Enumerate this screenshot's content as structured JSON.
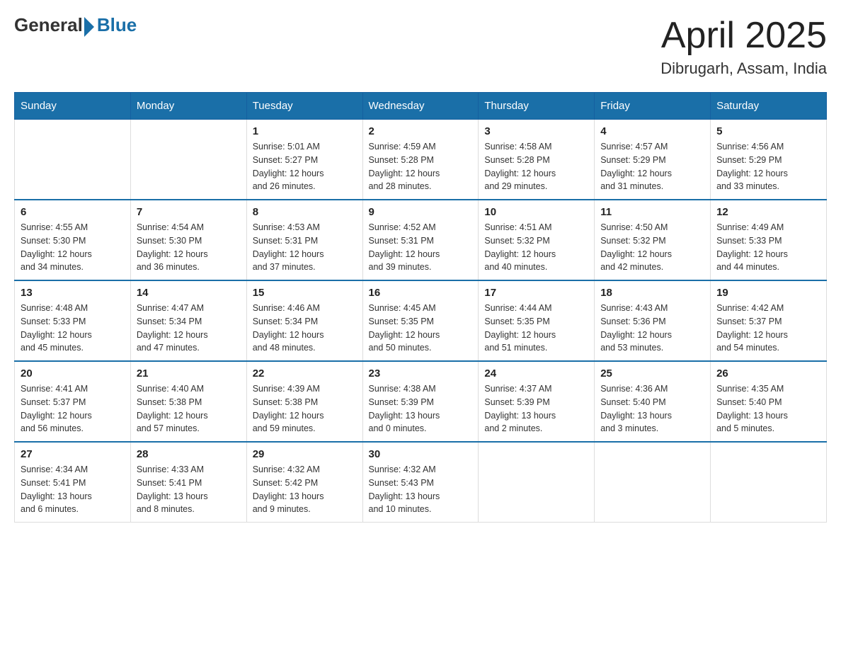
{
  "header": {
    "logo_general": "General",
    "logo_blue": "Blue",
    "title": "April 2025",
    "subtitle": "Dibrugarh, Assam, India"
  },
  "days_of_week": [
    "Sunday",
    "Monday",
    "Tuesday",
    "Wednesday",
    "Thursday",
    "Friday",
    "Saturday"
  ],
  "weeks": [
    [
      {
        "day": "",
        "info": ""
      },
      {
        "day": "",
        "info": ""
      },
      {
        "day": "1",
        "info": "Sunrise: 5:01 AM\nSunset: 5:27 PM\nDaylight: 12 hours\nand 26 minutes."
      },
      {
        "day": "2",
        "info": "Sunrise: 4:59 AM\nSunset: 5:28 PM\nDaylight: 12 hours\nand 28 minutes."
      },
      {
        "day": "3",
        "info": "Sunrise: 4:58 AM\nSunset: 5:28 PM\nDaylight: 12 hours\nand 29 minutes."
      },
      {
        "day": "4",
        "info": "Sunrise: 4:57 AM\nSunset: 5:29 PM\nDaylight: 12 hours\nand 31 minutes."
      },
      {
        "day": "5",
        "info": "Sunrise: 4:56 AM\nSunset: 5:29 PM\nDaylight: 12 hours\nand 33 minutes."
      }
    ],
    [
      {
        "day": "6",
        "info": "Sunrise: 4:55 AM\nSunset: 5:30 PM\nDaylight: 12 hours\nand 34 minutes."
      },
      {
        "day": "7",
        "info": "Sunrise: 4:54 AM\nSunset: 5:30 PM\nDaylight: 12 hours\nand 36 minutes."
      },
      {
        "day": "8",
        "info": "Sunrise: 4:53 AM\nSunset: 5:31 PM\nDaylight: 12 hours\nand 37 minutes."
      },
      {
        "day": "9",
        "info": "Sunrise: 4:52 AM\nSunset: 5:31 PM\nDaylight: 12 hours\nand 39 minutes."
      },
      {
        "day": "10",
        "info": "Sunrise: 4:51 AM\nSunset: 5:32 PM\nDaylight: 12 hours\nand 40 minutes."
      },
      {
        "day": "11",
        "info": "Sunrise: 4:50 AM\nSunset: 5:32 PM\nDaylight: 12 hours\nand 42 minutes."
      },
      {
        "day": "12",
        "info": "Sunrise: 4:49 AM\nSunset: 5:33 PM\nDaylight: 12 hours\nand 44 minutes."
      }
    ],
    [
      {
        "day": "13",
        "info": "Sunrise: 4:48 AM\nSunset: 5:33 PM\nDaylight: 12 hours\nand 45 minutes."
      },
      {
        "day": "14",
        "info": "Sunrise: 4:47 AM\nSunset: 5:34 PM\nDaylight: 12 hours\nand 47 minutes."
      },
      {
        "day": "15",
        "info": "Sunrise: 4:46 AM\nSunset: 5:34 PM\nDaylight: 12 hours\nand 48 minutes."
      },
      {
        "day": "16",
        "info": "Sunrise: 4:45 AM\nSunset: 5:35 PM\nDaylight: 12 hours\nand 50 minutes."
      },
      {
        "day": "17",
        "info": "Sunrise: 4:44 AM\nSunset: 5:35 PM\nDaylight: 12 hours\nand 51 minutes."
      },
      {
        "day": "18",
        "info": "Sunrise: 4:43 AM\nSunset: 5:36 PM\nDaylight: 12 hours\nand 53 minutes."
      },
      {
        "day": "19",
        "info": "Sunrise: 4:42 AM\nSunset: 5:37 PM\nDaylight: 12 hours\nand 54 minutes."
      }
    ],
    [
      {
        "day": "20",
        "info": "Sunrise: 4:41 AM\nSunset: 5:37 PM\nDaylight: 12 hours\nand 56 minutes."
      },
      {
        "day": "21",
        "info": "Sunrise: 4:40 AM\nSunset: 5:38 PM\nDaylight: 12 hours\nand 57 minutes."
      },
      {
        "day": "22",
        "info": "Sunrise: 4:39 AM\nSunset: 5:38 PM\nDaylight: 12 hours\nand 59 minutes."
      },
      {
        "day": "23",
        "info": "Sunrise: 4:38 AM\nSunset: 5:39 PM\nDaylight: 13 hours\nand 0 minutes."
      },
      {
        "day": "24",
        "info": "Sunrise: 4:37 AM\nSunset: 5:39 PM\nDaylight: 13 hours\nand 2 minutes."
      },
      {
        "day": "25",
        "info": "Sunrise: 4:36 AM\nSunset: 5:40 PM\nDaylight: 13 hours\nand 3 minutes."
      },
      {
        "day": "26",
        "info": "Sunrise: 4:35 AM\nSunset: 5:40 PM\nDaylight: 13 hours\nand 5 minutes."
      }
    ],
    [
      {
        "day": "27",
        "info": "Sunrise: 4:34 AM\nSunset: 5:41 PM\nDaylight: 13 hours\nand 6 minutes."
      },
      {
        "day": "28",
        "info": "Sunrise: 4:33 AM\nSunset: 5:41 PM\nDaylight: 13 hours\nand 8 minutes."
      },
      {
        "day": "29",
        "info": "Sunrise: 4:32 AM\nSunset: 5:42 PM\nDaylight: 13 hours\nand 9 minutes."
      },
      {
        "day": "30",
        "info": "Sunrise: 4:32 AM\nSunset: 5:43 PM\nDaylight: 13 hours\nand 10 minutes."
      },
      {
        "day": "",
        "info": ""
      },
      {
        "day": "",
        "info": ""
      },
      {
        "day": "",
        "info": ""
      }
    ]
  ]
}
